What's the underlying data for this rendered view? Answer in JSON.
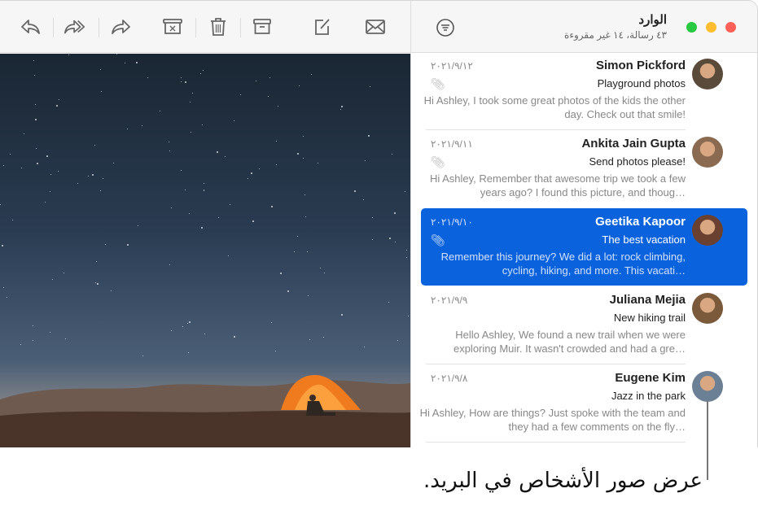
{
  "toolbar": {
    "icons": [
      "reply-icon",
      "reply-all-icon",
      "forward-icon",
      "junk-icon",
      "trash-icon",
      "archive-icon",
      "compose-icon",
      "mail-icon"
    ]
  },
  "mailbox": {
    "title": "الوارد",
    "subtitle": "٤٣ رسالة، ١٤ غير مقروءة"
  },
  "colors": {
    "selected": "#0a63dc",
    "close": "#fe5f57",
    "minimize": "#febc2e",
    "zoom": "#28c840"
  },
  "messages": [
    {
      "name": "Simon Pickford",
      "subject": "Playground photos",
      "preview": "Hi Ashley, I took some great photos of the kids the other day. Check out that smile!",
      "date": "٢٠٢١/٩/١٢",
      "attachment": true,
      "selected": false,
      "avatar": "#5a4a3a"
    },
    {
      "name": "Ankita Jain Gupta",
      "subject": "Send photos please!",
      "preview": "Hi Ashley, Remember that awesome trip we took a few years ago? I found this picture, and thoug…",
      "date": "٢٠٢١/٩/١١",
      "attachment": true,
      "selected": false,
      "avatar": "#8a6a50"
    },
    {
      "name": "Geetika Kapoor",
      "subject": "The best vacation",
      "preview": "Remember this journey? We did a lot: rock climbing, cycling, hiking, and more. This vacati…",
      "date": "٢٠٢١/٩/١٠",
      "attachment": true,
      "selected": true,
      "avatar": "#6a4030"
    },
    {
      "name": "Juliana Mejia",
      "subject": "New hiking trail",
      "preview": "Hello Ashley, We found a new trail when we were exploring Muir. It wasn't crowded and had a gre…",
      "date": "٢٠٢١/٩/٩",
      "attachment": false,
      "selected": false,
      "avatar": "#7a5a3a"
    },
    {
      "name": "Eugene Kim",
      "subject": "Jazz in the park",
      "preview": "Hi Ashley, How are things? Just spoke with the team and they had a few comments on the fly…",
      "date": "٢٠٢١/٩/٨",
      "attachment": false,
      "selected": false,
      "avatar": "#6b7f95"
    }
  ],
  "caption": "عرض صور الأشخاص في البريد."
}
